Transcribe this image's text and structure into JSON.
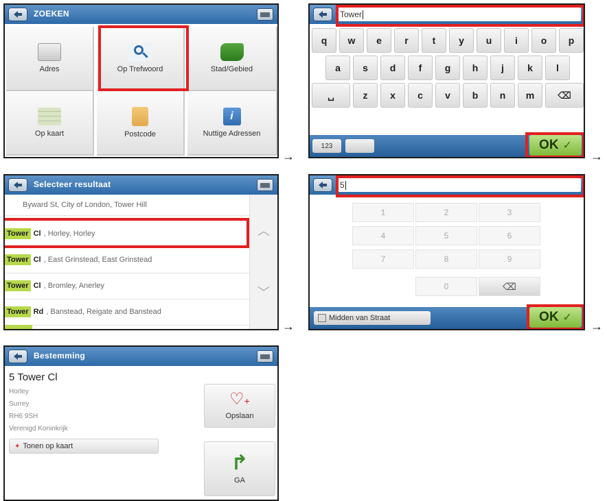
{
  "screen1": {
    "title": "ZOEKEN",
    "tiles": [
      {
        "label": "Adres",
        "icon": "keyboard-icon",
        "color": "#5c6670"
      },
      {
        "label": "Op Trefwoord",
        "icon": "magnifier-icon",
        "color": "#2d6aa8"
      },
      {
        "label": "Stad/Gebied",
        "icon": "map-region-icon",
        "color": "#3f8f2f"
      },
      {
        "label": "Op kaart",
        "icon": "grid-map-icon",
        "color": "#b7c6a0"
      },
      {
        "label": "Postcode",
        "icon": "envelope-icon",
        "color": "#e3a94b"
      },
      {
        "label": "Nuttige Adressen",
        "icon": "info-icon",
        "color": "#2f6db0"
      }
    ]
  },
  "screen2": {
    "search_value": "Tower",
    "keys_row1": [
      "q",
      "w",
      "e",
      "r",
      "t",
      "y",
      "u",
      "i",
      "o",
      "p"
    ],
    "keys_row2": [
      "a",
      "s",
      "d",
      "f",
      "g",
      "h",
      "j",
      "k",
      "l"
    ],
    "keys_row3": [
      "␣",
      "z",
      "x",
      "c",
      "v",
      "b",
      "n",
      "m",
      "⌫"
    ],
    "mode_label": "123",
    "ok_label": "OK"
  },
  "screen3": {
    "title": "Selecteer resultaat",
    "partial_row": "Byward St, City of London, Tower Hill",
    "rows": [
      {
        "tag": "Tower",
        "token": "Cl",
        "rest": ", Horley, Horley"
      },
      {
        "tag": "Tower",
        "token": "Cl",
        "rest": ", East Grinstead, East Grinstead"
      },
      {
        "tag": "Tower",
        "token": "Cl",
        "rest": ", Bromley, Anerley"
      },
      {
        "tag": "Tower",
        "token": "Rd",
        "rest": ", Banstead, Reigate and Banstead"
      }
    ]
  },
  "screen4": {
    "search_value": "5",
    "num_keys": [
      "1",
      "2",
      "3",
      "4",
      "5",
      "6",
      "7",
      "8",
      "9",
      "0"
    ],
    "midden_label": "Midden van Straat",
    "ok_label": "OK"
  },
  "screen5": {
    "title": "Bestemming",
    "address_title": "5 Tower Cl",
    "address_lines": [
      "Horley",
      "Surrey",
      "RH6 9SH",
      "Verenigd Koninkrijk"
    ],
    "map_button": "Tonen op kaart",
    "save_label": "Opslaan",
    "go_label": "GA"
  },
  "arrow_glyph": "→",
  "colors": {
    "highlight": "#e12020",
    "title_blue": "#2d6aa8",
    "ok_green": "#8cc441",
    "tag_green": "#b7d84a"
  }
}
